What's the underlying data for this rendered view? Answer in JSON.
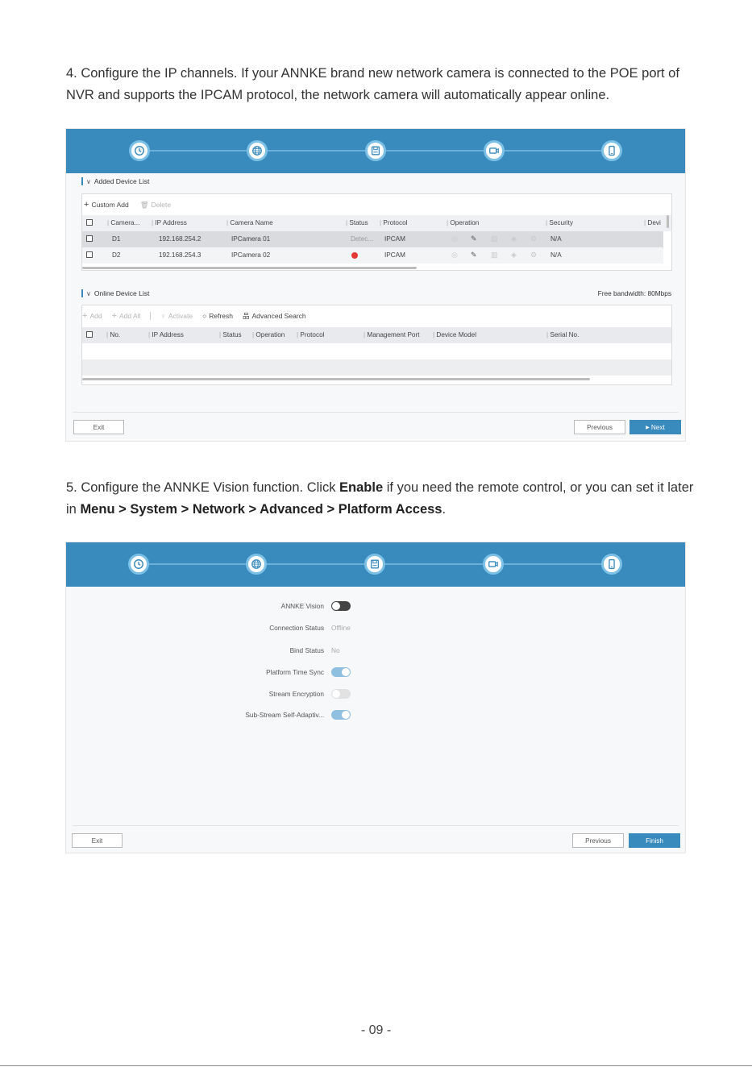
{
  "step4": {
    "text": "4. Configure the IP channels. If your ANNKE brand new network camera is connected to the POE port of NVR and supports the IPCAM protocol, the network camera will automatically appear online."
  },
  "step5": {
    "intro": "5. Configure the ANNKE Vision function. Click ",
    "enable": "Enable",
    "middle": " if you need the remote control, or you can set it later in ",
    "path": "Menu > System > Network > Advanced > Platform Access",
    "end": "."
  },
  "wizard_icons": [
    "clock-icon",
    "globe-icon",
    "disk-icon",
    "camera-icon",
    "phone-icon"
  ],
  "screen1": {
    "added_title": "Added Device List",
    "custom_add": "Custom Add",
    "delete": "Delete",
    "columns": [
      "Camera...",
      "IP Address",
      "Camera Name",
      "Status",
      "Protocol",
      "Operation",
      "Security",
      "Devi"
    ],
    "rows": [
      {
        "camera": "D1",
        "ip": "192.168.254.2",
        "name": "IPCamera 01",
        "status": "Detec...",
        "protocol": "IPCAM",
        "security": "N/A"
      },
      {
        "camera": "D2",
        "ip": "192.168.254.3",
        "name": "IPCamera 02",
        "status": "",
        "protocol": "IPCAM",
        "security": "N/A"
      }
    ],
    "online_title": "Online Device List",
    "bandwidth": "Free bandwidth: 80Mbps",
    "add": "Add",
    "add_all": "Add All",
    "activate": "Activate",
    "refresh": "Refresh",
    "advanced_search": "Advanced Search",
    "online_columns": [
      "No.",
      "IP Address",
      "Status",
      "Operation",
      "Protocol",
      "Management Port",
      "Device Model",
      "Serial No."
    ],
    "exit": "Exit",
    "previous": "Previous",
    "next": "Next"
  },
  "screen2": {
    "fields": [
      {
        "label": "ANNKE Vision",
        "type": "toggle",
        "state": "off"
      },
      {
        "label": "Connection Status",
        "type": "text",
        "value": "Offline"
      },
      {
        "label": "Bind Status",
        "type": "text",
        "value": "No"
      },
      {
        "label": "Platform Time Sync",
        "type": "toggle",
        "state": "on"
      },
      {
        "label": "Stream Encryption",
        "type": "toggle",
        "state": "disabled"
      },
      {
        "label": "Sub-Stream Self-Adaptiv...",
        "type": "toggle",
        "state": "on"
      }
    ],
    "exit": "Exit",
    "previous": "Previous",
    "finish": "Finish"
  },
  "page_number": "- 09 -"
}
